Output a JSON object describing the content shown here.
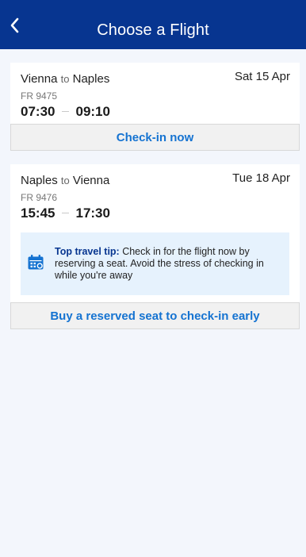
{
  "header": {
    "title": "Choose a Flight",
    "back_icon": "chevron-left-icon",
    "background": "#073590"
  },
  "flights": [
    {
      "from": "Vienna",
      "to_word": "to",
      "to": "Naples",
      "date": "Sat 15 Apr",
      "flight_number": "FR 9475",
      "depart": "07:30",
      "arrive": "09:10",
      "action_label": "Check-in now"
    },
    {
      "from": "Naples",
      "to_word": "to",
      "to": "Vienna",
      "date": "Tue 18 Apr",
      "flight_number": "FR 9476",
      "depart": "15:45",
      "arrive": "17:30",
      "tip": {
        "icon": "calendar-seat-icon",
        "lead": "Top travel tip:",
        "text": " Check in for the flight now by reserving a seat. Avoid the stress of checking in while you're away"
      },
      "action_label": "Buy a reserved seat to check-in early"
    }
  ],
  "colors": {
    "accent": "#1573d1",
    "page_background": "#f3f6fc",
    "tip_background": "#e6f2fd"
  }
}
